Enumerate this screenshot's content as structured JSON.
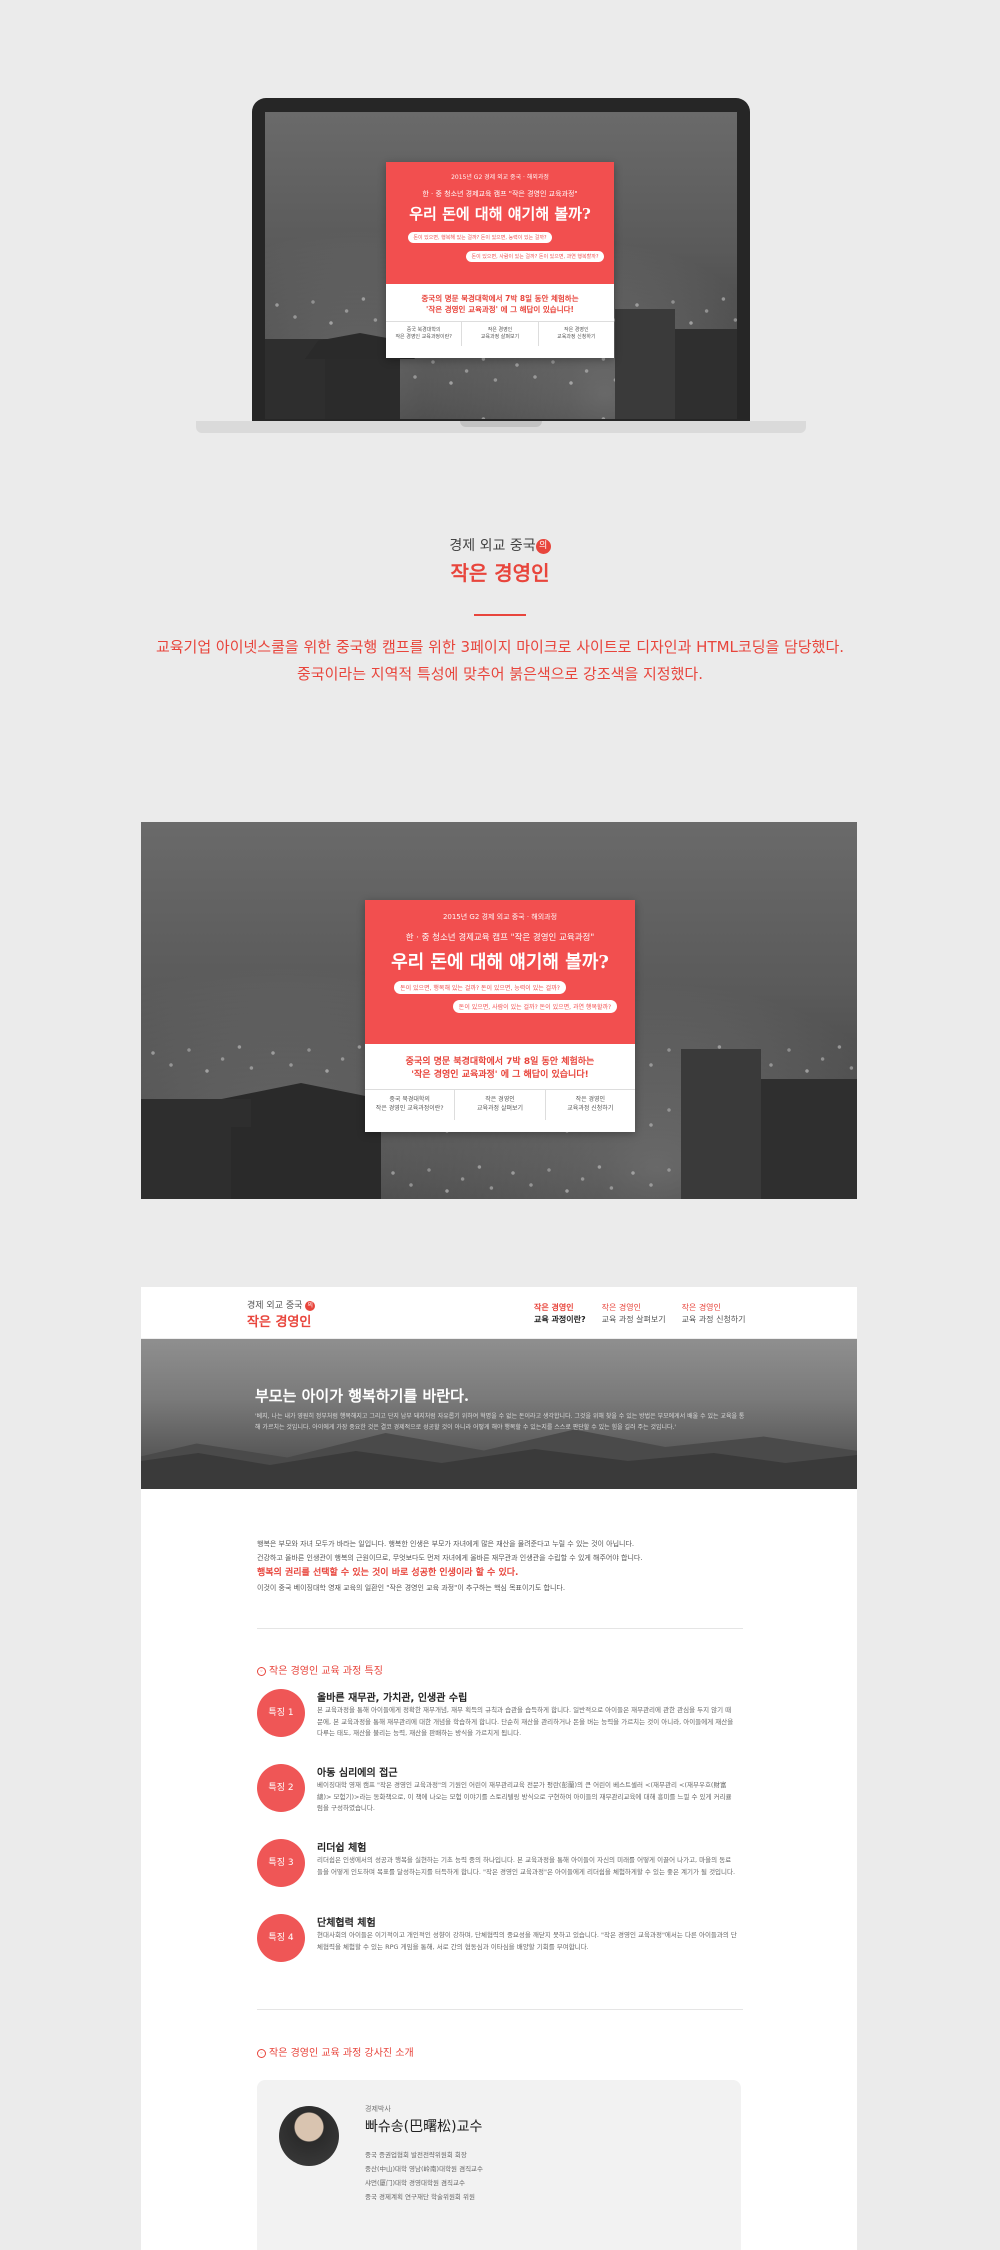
{
  "promo": {
    "small_title": "2015년 G2 경제 외교 중국 · 해외과정",
    "tag": "한 · 중 청소년 경제교육 캠프 \"작은 경영인 교육과정\"",
    "headline": "우리 돈에 대해 얘기해 볼까?",
    "bubble1": "돈이 있으면, 행복해 있는 걸까? 돈이 있으면, 능력이 있는 걸까?",
    "bubble2": "돈이 있으면, 사람이 있는 걸까? 돈이 있으면, 과연 행복할까?",
    "main_line1": "중국의 명문 북경대학에서 7박 8일 동안 체험하는",
    "main_line2": "'작은 경영인 교육과정' 에 그 해답이 있습니다!",
    "links": [
      {
        "line1": "중국 북경대학의",
        "line2": "작은 경영인 교육과정이란?"
      },
      {
        "line1": "작은 경영인",
        "line2": "교육과정 살펴보기"
      },
      {
        "line1": "작은 경영인",
        "line2": "교육과정 신청하기"
      }
    ]
  },
  "project": {
    "logo_line1": "경제 외교 중국",
    "logo_dot": "의",
    "logo_line2": "작은 경영인",
    "desc_line1": "교육기업 아이넷스쿨을 위한 중국행 캠프를 위한 3페이지 마이크로 사이트로 디자인과 HTML코딩을 담당했다.",
    "desc_line2": "중국이라는 지역적 특성에 맞추어 붉은색으로 강조색을 지정했다."
  },
  "site": {
    "logo_line1": "경제 외교 중국",
    "logo_dot": "의",
    "logo_line2": "작은 경영인",
    "nav": [
      {
        "line1": "작은 경영인",
        "line2": "교육 과정이란?",
        "active": true
      },
      {
        "line1": "작은 경영인",
        "line2": "교육 과정 살펴보기",
        "active": false
      },
      {
        "line1": "작은 경영인",
        "line2": "교육 과정 신청하기",
        "active": false
      }
    ],
    "hero_title": "부모는 아이가 행복하기를 바란다.",
    "hero_sub": "'베지, 나는 내가 영원히 정부처럼 행복해지고 그리고 단지 남부 돼지처럼 자유롭기 위하여 혁명을 수 없는 돈이라고 생각합니다. 그것을 위해 찾을 수 있는 방법은 부모에게서 배울 수 있는 교육을 통해 가르치는 것입니다. 아이에게 가장 중요한 것은 결코 경제적으로 성공할 것이 아니라 어떻게 해야 행복할 수 있는지를 스스로 판단할 수 있는 힘을 길러 주는 것입니다.'",
    "intro": {
      "line1": "행복은 부모와 자녀 모두가 바라는 일입니다. 행복한 인생은 부모가 자녀에게 많은 재산을 물려준다고 누릴 수 있는 것이 아닙니다.",
      "line2": "건강하고 올바른 인생관이 행복의 근원이므로, 무엇보다도 먼저 자녀에게 올바른 재무관과 인생관을 수립할 수 있게 해주어야 합니다.",
      "emph": "행복의 권리를 선택할 수 있는 것이 바로 성공한 인생이라 할 수 있다.",
      "line3": "이것이 중국 베이징대학 영재 교육의 일환인 \"작은 경영인 교육 과정\"이 추구하는 핵심 목표이기도 합니다."
    },
    "features_title": "작은 경영인 교육 과정 특징",
    "features": [
      {
        "badge": "특징 1",
        "title": "올바른 재무관, 가치관, 인생관 수립",
        "desc": "본 교육과정을 통해 아이들에게 정확한 재무개념, 재무 획득의 규칙과 습관을 습득하게 합니다. 일반적으로 아이들은 재무관리에 관한 관심을 두지 않기 때문에, 본 교육과정을 통해 재무관리에 대한 개념을 학습하게 합니다. 단순히 재산을 관리하거나 돈을 버는 능력을 가르치는 것이 아니라, 아이들에게 재산을 다루는 태도, 재산을 불리는 능력, 재산을 판배하는 방식을 가르치게 됩니다."
      },
      {
        "badge": "특징 2",
        "title": "아동 심리에의 접근",
        "desc": "베이징대학 영재 캠프 \"작은 경영인 교육과정\"의 기원인 어린이 재무관리교육 전문가 펑란(彭蘭)의 큰 어린이 베스트셀러 <(재무관리 <(재부우호(財富總)> 모험기)>라는 동화책으로, 이 책에 나오는 모험 이야기를 스토리텔링 방식으로 구현하여 아이들의 재무관리교육에 대해 흥미를 느낄 수 있게 커리큘럼을 구성하였습니다."
      },
      {
        "badge": "특징 3",
        "title": "리더쉽 체험",
        "desc": "리더쉽은 인생에서의 성공과 행복을 실현하는 기초 능력 중의 하나입니다. 본 교육과정을 통해 아이들이 자신의 미래를 어떻게 이끌어 나가고, 마을의 동료들을 어떻게 인도하며 목표를 달성하는지를 터득하게 합니다. \"작은 경영인 교육과정\"은 아이들에게 리더쉽을 체험하게할 수 있는 좋은 계기가 될 것입니다."
      },
      {
        "badge": "특징 4",
        "title": "단체협력 체험",
        "desc": "현대사회의 아이들은 이기적이고 개인적인 성향이 강하며, 단체협력의 중요성을 깨닫지 못하고 있습니다. \"작은 경영인 교육과정\"에서는 다른 아이들과의 단체협력을 체험할 수 있는 RPG 게임을 통해, 서로 간의 협동심과 이타심을 배양할 기회를 부여합니다."
      }
    ],
    "instructors_title": "작은 경영인 교육 과정 강사진 소개",
    "instructor": {
      "role": "경제박사",
      "name": "빠슈송(巴曙松)교수",
      "career": [
        "중국 증권업협회 발전전략위원회 회장",
        "중산(中山)대학 영남(岭南)대학원 겸직교수",
        "샤먼(厦门)대학 경영대학원 겸직교수",
        "중국 경제계획 연구재단 학술위원회 위원"
      ]
    }
  }
}
